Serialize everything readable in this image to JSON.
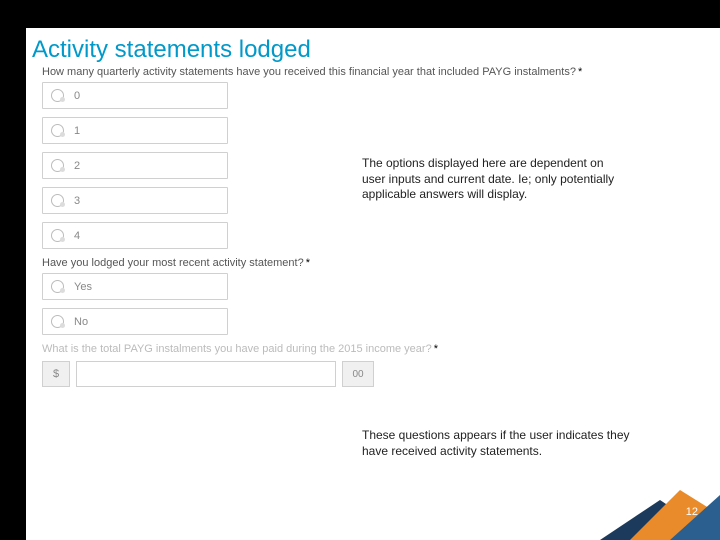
{
  "title": "Activity statements lodged",
  "q1": {
    "text": "How many quarterly activity statements have you received this financial year that included PAYG instalments?",
    "required": "*",
    "options": [
      "0",
      "1",
      "2",
      "3",
      "4"
    ]
  },
  "note1": "The options displayed here are dependent on user inputs and current date.  Ie; only potentially applicable answers will display.",
  "q2": {
    "text": "Have you lodged your most recent activity statement?",
    "required": "*",
    "options": [
      "Yes",
      "No"
    ]
  },
  "note2": "These questions appears if the user indicates they have received activity statements.",
  "q3": {
    "text": "What is the total PAYG instalments you have paid during the 2015 income year?",
    "required": "*",
    "currency": "$",
    "cents": "00"
  },
  "page": "12"
}
